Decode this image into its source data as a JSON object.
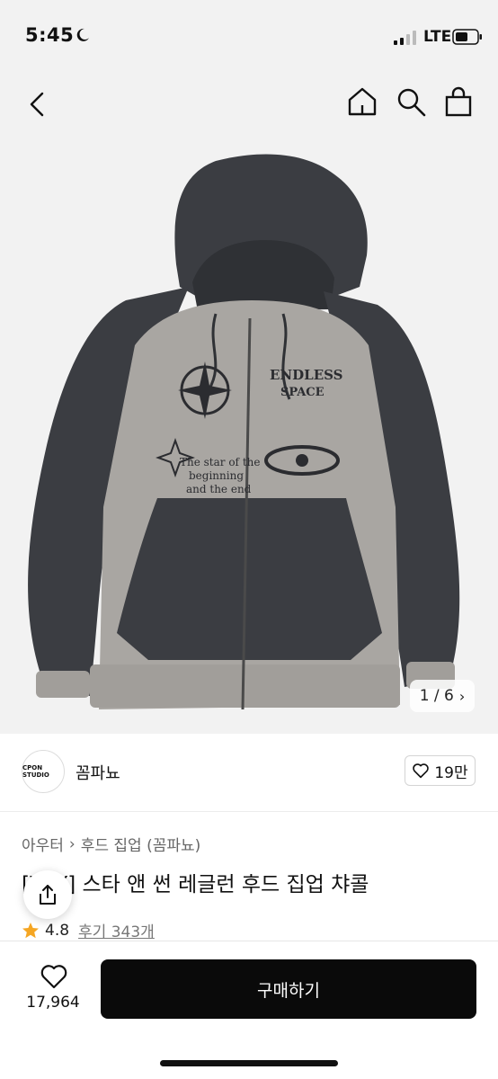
{
  "status_bar": {
    "time": "5:45",
    "network": "LTE"
  },
  "nav": {
    "icons": [
      "back-icon",
      "home-icon",
      "search-icon",
      "shopping-bag-icon"
    ]
  },
  "gallery": {
    "counter": "1 / 6"
  },
  "brand": {
    "logo_text": "CPON STUDIO",
    "name": "꼼파뇨",
    "like_count": "19만"
  },
  "product": {
    "breadcrumb": [
      "아우터",
      "후드 집업 (꼼파뇨)"
    ],
    "title": "[VAY] 스타 앤 썬 레글런 후드 집업 챠콜",
    "rating": "4.8",
    "reviews": "후기 343개"
  },
  "bottom_bar": {
    "wish_count": "17,964",
    "buy_label": "구매하기"
  },
  "colors": {
    "star": "#f5a623",
    "buy_button": "#0a0a0a",
    "hoodie_dark": "#3b3d42",
    "hoodie_light": "#a9a6a2"
  }
}
